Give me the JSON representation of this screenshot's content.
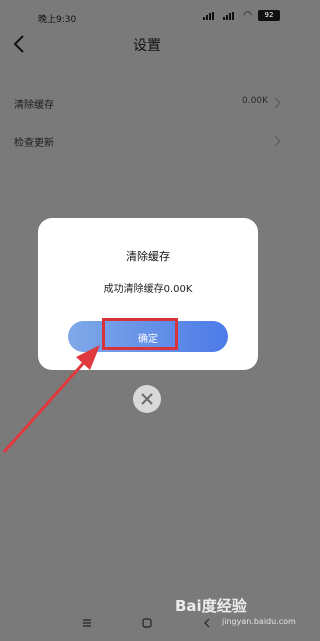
{
  "status": {
    "time": "晚上9:30",
    "battery": "92"
  },
  "header": {
    "title": "设置"
  },
  "settings": [
    {
      "label": "清除缓存",
      "value": "0.00K"
    },
    {
      "label": "检查更新",
      "value": ""
    }
  ],
  "dialog": {
    "title": "清除缓存",
    "message": "成功清除缓存0.00K",
    "confirm_label": "确定"
  },
  "watermark": {
    "brand": "Bai度经验",
    "url": "jingyan.baidu.com"
  },
  "colors": {
    "accent": "#4d7be8",
    "highlight": "#d8323a",
    "backdrop": "#7a7a7a"
  }
}
